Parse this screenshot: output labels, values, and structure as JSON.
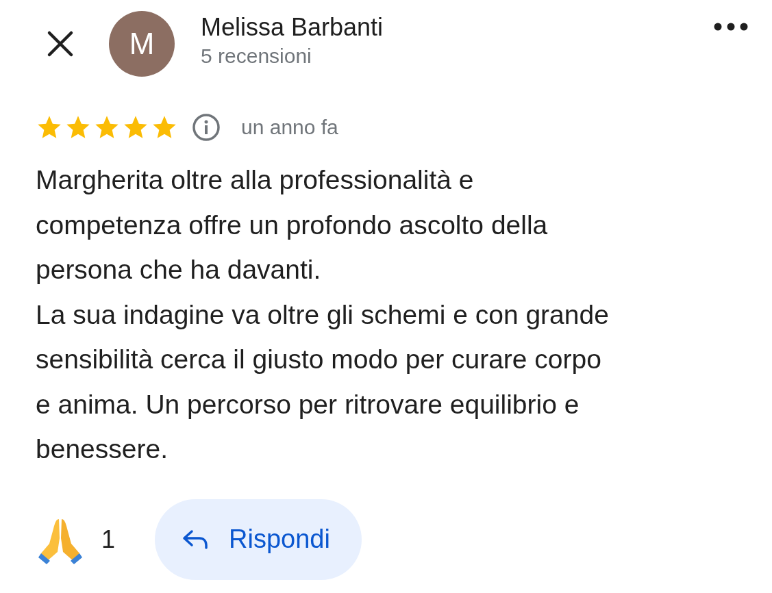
{
  "header": {
    "avatar_letter": "M",
    "name": "Melissa Barbanti",
    "subtitle": "5 recensioni"
  },
  "review": {
    "stars": 5,
    "time": "un anno fa",
    "text": "Margherita oltre alla professionalità e\ncompetenza offre un profondo ascolto della\npersona che ha davanti.\nLa sua indagine va oltre gli schemi e con grande\nsensibilità cerca il giusto modo per curare corpo\ne anima. Un percorso per ritrovare equilibrio e\nbenessere."
  },
  "reactions": {
    "count": "1"
  },
  "reply_button": {
    "label": "Rispondi"
  }
}
